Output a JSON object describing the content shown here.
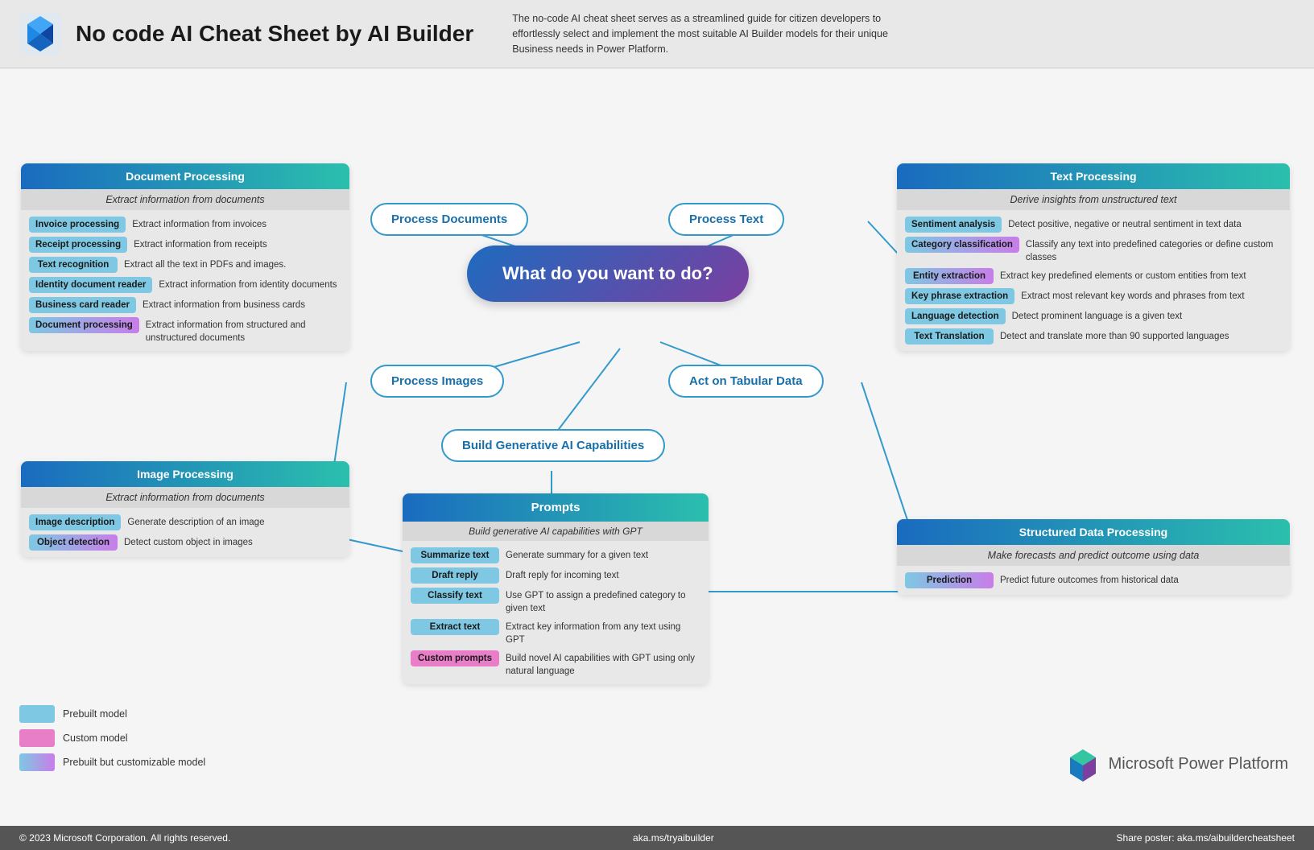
{
  "header": {
    "title": "No code AI Cheat Sheet by AI Builder",
    "description": "The no-code AI cheat sheet serves as a streamlined guide for citizen developers to effortlessly select and implement the most suitable AI Builder models for their unique Business needs in Power Platform."
  },
  "center_node": "What do you want to do?",
  "flow_nodes": {
    "process_documents": "Process Documents",
    "process_text": "Process Text",
    "process_images": "Process Images",
    "act_on_tabular": "Act on Tabular Data",
    "build_gen_ai": "Build Generative AI Capabilities"
  },
  "document_processing": {
    "title": "Document Processing",
    "subtitle": "Extract information from documents",
    "items": [
      {
        "label": "Invoice processing",
        "desc": "Extract information from invoices",
        "color": "blue"
      },
      {
        "label": "Receipt processing",
        "desc": "Extract information from receipts",
        "color": "blue"
      },
      {
        "label": "Text  recognition",
        "desc": "Extract all the text in PDFs and images.",
        "color": "blue"
      },
      {
        "label": "Identity document reader",
        "desc": "Extract information from identity documents",
        "color": "blue"
      },
      {
        "label": "Business card reader",
        "desc": "Extract information from business cards",
        "color": "blue"
      },
      {
        "label": "Document processing",
        "desc": "Extract information from structured and unstructured documents",
        "color": "teal"
      }
    ]
  },
  "text_processing": {
    "title": "Text Processing",
    "subtitle": "Derive insights from unstructured text",
    "items": [
      {
        "label": "Sentiment analysis",
        "desc": "Detect positive, negative or neutral sentiment in text data",
        "color": "blue"
      },
      {
        "label": "Category classification",
        "desc": "Classify any text into predefined categories or define custom classes",
        "color": "teal"
      },
      {
        "label": "Entity extraction",
        "desc": "Extract key predefined elements or custom entities from text",
        "color": "teal"
      },
      {
        "label": "Key phrase extraction",
        "desc": "Extract most relevant key words and phrases from text",
        "color": "blue"
      },
      {
        "label": "Language detection",
        "desc": "Detect prominent language is a given text",
        "color": "blue"
      },
      {
        "label": "Text Translation",
        "desc": "Detect and translate more than 90 supported languages",
        "color": "blue"
      }
    ]
  },
  "image_processing": {
    "title": "Image Processing",
    "subtitle": "Extract information from documents",
    "items": [
      {
        "label": "Image description",
        "desc": "Generate description of an image",
        "color": "blue"
      },
      {
        "label": "Object detection",
        "desc": "Detect custom object in images",
        "color": "teal"
      }
    ]
  },
  "structured_data": {
    "title": "Structured Data Processing",
    "subtitle": "Make forecasts and predict outcome using data",
    "items": [
      {
        "label": "Prediction",
        "desc": "Predict future outcomes from historical data",
        "color": "teal"
      }
    ]
  },
  "prompts": {
    "title": "Prompts",
    "subtitle": "Build generative AI capabilities with GPT",
    "items": [
      {
        "label": "Summarize text",
        "desc": "Generate summary for a given text",
        "color": "blue"
      },
      {
        "label": "Draft reply",
        "desc": "Draft reply for incoming text",
        "color": "blue"
      },
      {
        "label": "Classify text",
        "desc": "Use GPT to assign a predefined category to given text",
        "color": "blue"
      },
      {
        "label": "Extract text",
        "desc": "Extract key information from any text using GPT",
        "color": "blue"
      },
      {
        "label": "Custom prompts",
        "desc": "Build novel AI capabilities with GPT using only natural language",
        "color": "pink"
      }
    ]
  },
  "legend": [
    {
      "label": "Prebuilt model",
      "color": "blue"
    },
    {
      "label": "Custom model",
      "color": "pink"
    },
    {
      "label": "Prebuilt but customizable model",
      "color": "teal"
    }
  ],
  "footer": {
    "copyright": "© 2023 Microsoft Corporation. All rights reserved.",
    "url": "aka.ms/tryaibuilder",
    "share": "Share poster: aka.ms/aibuildercheatsheet"
  },
  "ms_logo_text": "Microsoft Power Platform"
}
